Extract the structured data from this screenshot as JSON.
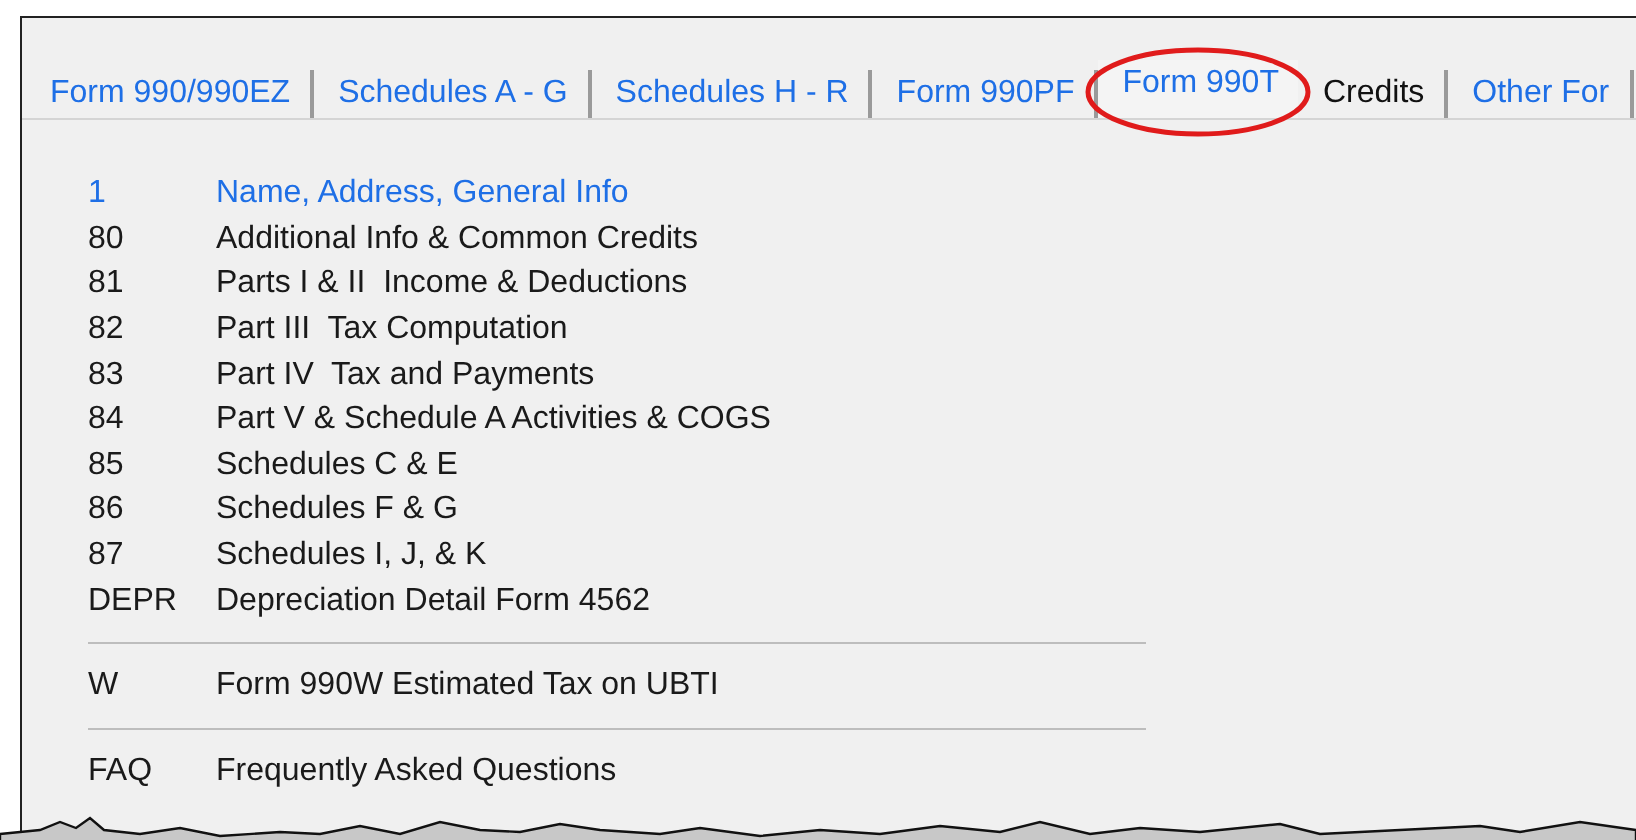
{
  "tabs": [
    {
      "label": "Form 990/990EZ",
      "selected": false,
      "color": "#1e6fe6"
    },
    {
      "label": "Schedules A - G",
      "selected": false,
      "color": "#1e6fe6"
    },
    {
      "label": "Schedules H - R",
      "selected": false,
      "color": "#1e6fe6"
    },
    {
      "label": "Form 990PF",
      "selected": false,
      "color": "#1e6fe6"
    },
    {
      "label": "Form 990T",
      "selected": true,
      "color": "#1e6fe6"
    },
    {
      "label": "Credits",
      "selected": false,
      "color": "#111111"
    },
    {
      "label": "Other For",
      "selected": false,
      "color": "#1e6fe6"
    }
  ],
  "sections": [
    {
      "items": [
        {
          "code": "1",
          "label": "Name, Address, General Info",
          "selected": true
        },
        {
          "code": "80",
          "label": "Additional Info & Common Credits",
          "selected": false
        },
        {
          "code": "81",
          "label": "Parts I & II  Income & Deductions",
          "selected": false
        },
        {
          "code": "82",
          "label": "Part III  Tax Computation",
          "selected": false
        },
        {
          "code": "83",
          "label": "Part IV  Tax and Payments",
          "selected": false
        },
        {
          "code": "84",
          "label": "Part V & Schedule A Activities & COGS",
          "selected": false
        },
        {
          "code": "85",
          "label": "Schedules C & E",
          "selected": false
        },
        {
          "code": "86",
          "label": "Schedules F & G",
          "selected": false
        },
        {
          "code": "87",
          "label": "Schedules I, J, & K",
          "selected": false
        },
        {
          "code": "DEPR",
          "label": "Depreciation Detail Form 4562",
          "selected": false
        }
      ]
    },
    {
      "items": [
        {
          "code": "W",
          "label": "Form 990W Estimated Tax on UBTI",
          "selected": false
        }
      ]
    },
    {
      "items": [
        {
          "code": "FAQ",
          "label": "Frequently Asked Questions",
          "selected": false
        }
      ]
    }
  ]
}
